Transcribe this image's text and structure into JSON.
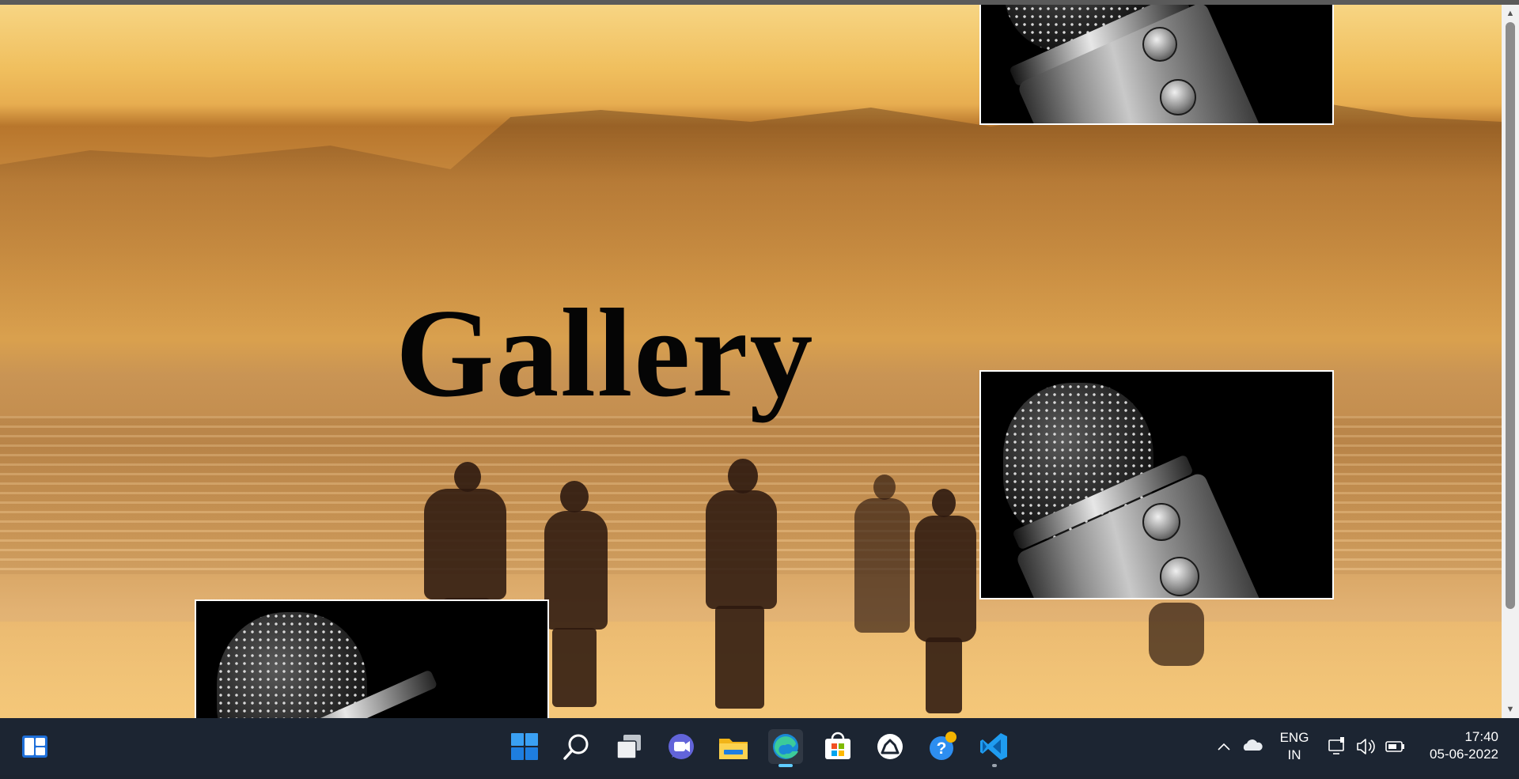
{
  "page": {
    "title": "Gallery"
  },
  "gallery": {
    "images": [
      {
        "subject": "microphone"
      },
      {
        "subject": "microphone"
      },
      {
        "subject": "microphone"
      }
    ]
  },
  "scrollbar": {
    "up_icon": "▲",
    "down_icon": "▼"
  },
  "taskbar": {
    "icons": [
      "widgets-icon",
      "start-icon",
      "search-icon",
      "task-view-icon",
      "teams-chat-icon",
      "file-explorer-icon",
      "edge-icon",
      "microsoft-store-icon",
      "app-icon",
      "get-help-icon",
      "vscode-icon"
    ],
    "tray": {
      "language_line1": "ENG",
      "language_line2": "IN",
      "time": "17:40",
      "date": "05-06-2022"
    }
  },
  "colors": {
    "taskbar_bg": "#1c2532",
    "accent_indicator": "#60cdff",
    "title_text": "#050505",
    "photo_border": "#ffffff"
  }
}
